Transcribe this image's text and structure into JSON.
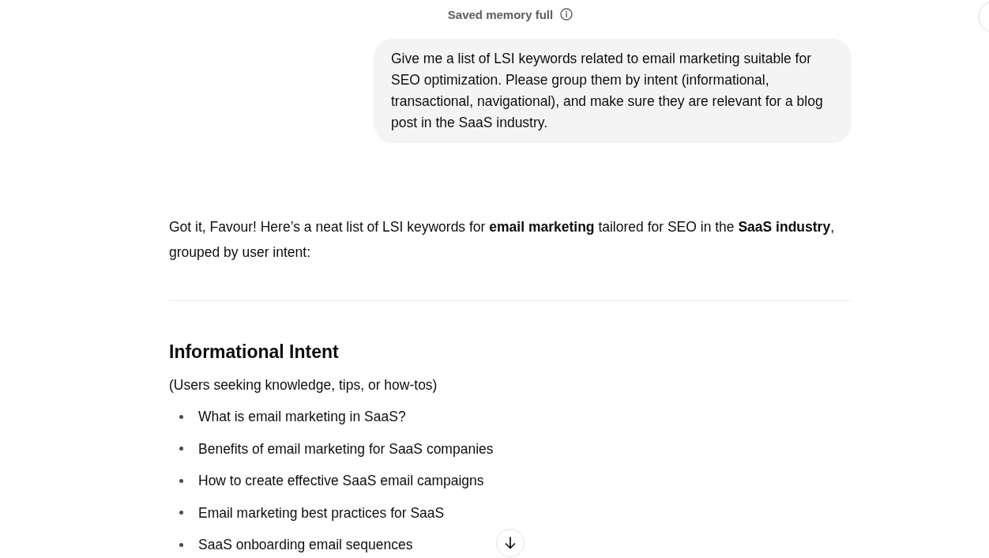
{
  "header": {
    "status": "Saved memory full"
  },
  "conversation": {
    "user_message": "Give me a list of LSI keywords related to email marketing suitable for SEO optimization. Please group them by intent (informational, transactional, navigational), and make sure they are relevant for a blog post in the SaaS industry.",
    "assistant_message": {
      "intro": "Got it, Favour! Here’s a neat list of LSI keywords for **email marketing** tailored for SEO in the **SaaS industry**, grouped by user intent:",
      "sections": [
        {
          "heading": "Informational Intent",
          "description": "(Users seeking knowledge, tips, or how-tos)",
          "items": [
            "What is email marketing in SaaS?",
            "Benefits of email marketing for SaaS companies",
            "How to create effective SaaS email campaigns",
            "Email marketing best practices for SaaS",
            "SaaS onboarding email sequences"
          ]
        }
      ]
    }
  }
}
